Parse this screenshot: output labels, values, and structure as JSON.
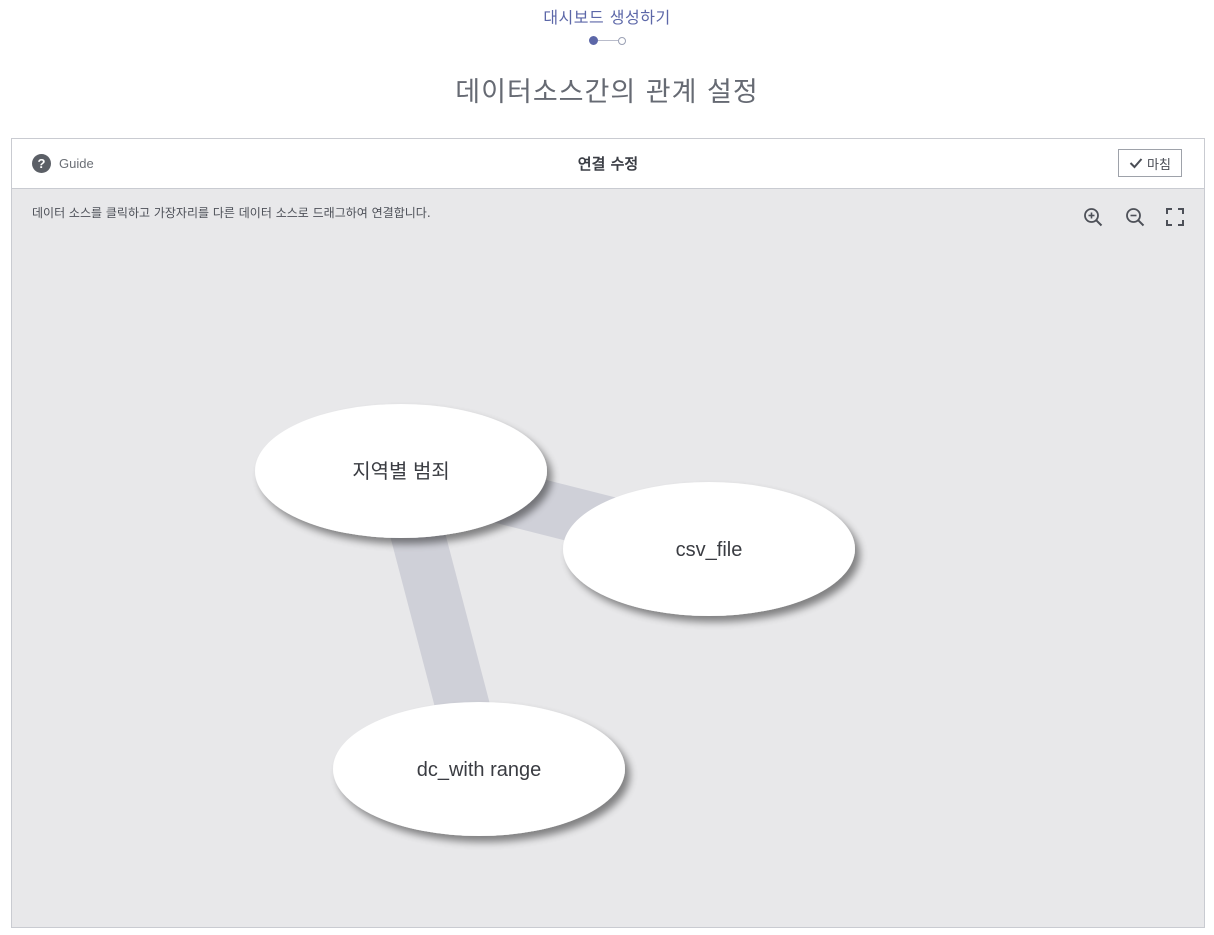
{
  "wizard": {
    "title": "대시보드 생성하기",
    "step_current": 1,
    "step_total": 2,
    "page_title": "데이터소스간의 관계 설정"
  },
  "panel": {
    "guide_label": "Guide",
    "title": "연결 수정",
    "done_label": "마침",
    "instruction": "데이터 소스를 클릭하고 가장자리를 다른 데이터 소스로 드래그하여 연결합니다."
  },
  "toolbar": {
    "icons": [
      "zoom-in-icon",
      "zoom-out-icon",
      "fit-screen-icon"
    ]
  },
  "graph": {
    "nodes": [
      {
        "id": "n1",
        "label": "지역별 범죄"
      },
      {
        "id": "n2",
        "label": "csv_file"
      },
      {
        "id": "n3",
        "label": "dc_with range"
      }
    ],
    "edges": [
      {
        "from": "n1",
        "to": "n2"
      },
      {
        "from": "n1",
        "to": "n3"
      }
    ]
  },
  "colors": {
    "accent": "#5c67a8",
    "canvas_bg": "#e8e8ea",
    "edge": "#cfd0d8",
    "node_fill": "#ffffff"
  }
}
